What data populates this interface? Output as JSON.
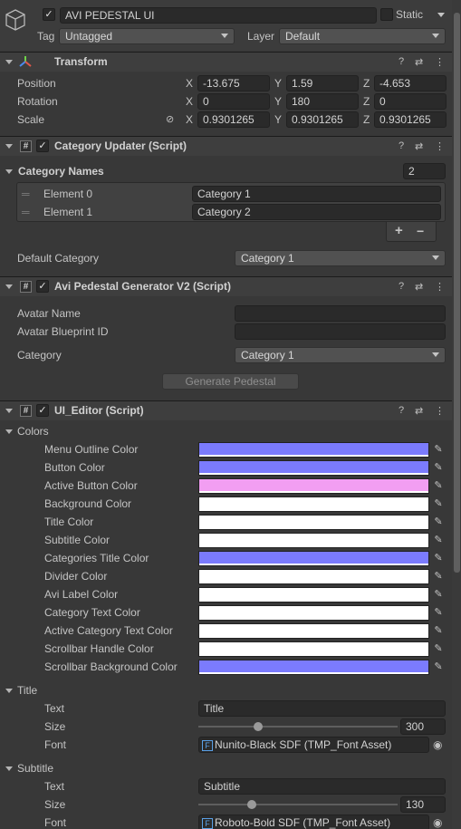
{
  "object": {
    "name": "AVI PEDESTAL UI",
    "static_label": "Static",
    "tag_label": "Tag",
    "tag_value": "Untagged",
    "layer_label": "Layer",
    "layer_value": "Default"
  },
  "transform": {
    "title": "Transform",
    "position_label": "Position",
    "rotation_label": "Rotation",
    "scale_label": "Scale",
    "axis_x": "X",
    "axis_y": "Y",
    "axis_z": "Z",
    "position": {
      "x": "-13.675",
      "y": "1.59",
      "z": "-4.653"
    },
    "rotation": {
      "x": "0",
      "y": "180",
      "z": "0"
    },
    "scale": {
      "x": "0.9301265",
      "y": "0.9301265",
      "z": "0.9301265"
    }
  },
  "category_updater": {
    "title": "Category Updater (Script)",
    "names_label": "Category Names",
    "names_count": "2",
    "elements": [
      {
        "label": "Element 0",
        "value": "Category 1"
      },
      {
        "label": "Element 1",
        "value": "Category 2"
      }
    ],
    "add_label": "+",
    "remove_label": "−",
    "default_label": "Default Category",
    "default_value": "Category 1"
  },
  "generator": {
    "title": "Avi Pedestal Generator V2 (Script)",
    "avatar_name_label": "Avatar Name",
    "avatar_name_value": "",
    "blueprint_label": "Avatar Blueprint ID",
    "blueprint_value": "",
    "category_label": "Category",
    "category_value": "Category 1",
    "generate_label": "Generate Pedestal"
  },
  "ui_editor": {
    "title": "UI_Editor (Script)",
    "colors_label": "Colors",
    "colors": [
      {
        "label": "Menu Outline Color",
        "color": "#7b7bfd"
      },
      {
        "label": "Button Color",
        "color": "#7b7bfd"
      },
      {
        "label": "Active Button Color",
        "color": "#f29ef2"
      },
      {
        "label": "Background Color",
        "color": "#ffffff"
      },
      {
        "label": "Title Color",
        "color": "#ffffff"
      },
      {
        "label": "Subtitle Color",
        "color": "#ffffff"
      },
      {
        "label": "Categories Title Color",
        "color": "#7b7bfd"
      },
      {
        "label": "Divider Color",
        "color": "#ffffff"
      },
      {
        "label": "Avi Label Color",
        "color": "#ffffff"
      },
      {
        "label": "Category Text Color",
        "color": "#ffffff"
      },
      {
        "label": "Active Category Text Color",
        "color": "#ffffff"
      },
      {
        "label": "Scrollbar Handle Color",
        "color": "#ffffff"
      },
      {
        "label": "Scrollbar Background Color",
        "color": "#7b7bfd"
      }
    ],
    "title_section": {
      "label": "Title",
      "text_label": "Text",
      "text_value": "Title",
      "size_label": "Size",
      "size_value": "300",
      "size_fraction": 0.3,
      "font_label": "Font",
      "font_value": "Nunito-Black SDF (TMP_Font Asset)"
    },
    "subtitle_section": {
      "label": "Subtitle",
      "text_label": "Text",
      "text_value": "Subtitle",
      "size_label": "Size",
      "size_value": "130",
      "size_fraction": 0.27,
      "font_label": "Font",
      "font_value": "Roboto-Bold SDF (TMP_Font Asset)"
    }
  },
  "icons": {
    "help": "?",
    "settings": "⇄",
    "menu": "⋮",
    "checkmark": "✓",
    "picker": "✎",
    "hash": "#",
    "font_asset": "F",
    "link": "⊘",
    "target": "◉"
  }
}
